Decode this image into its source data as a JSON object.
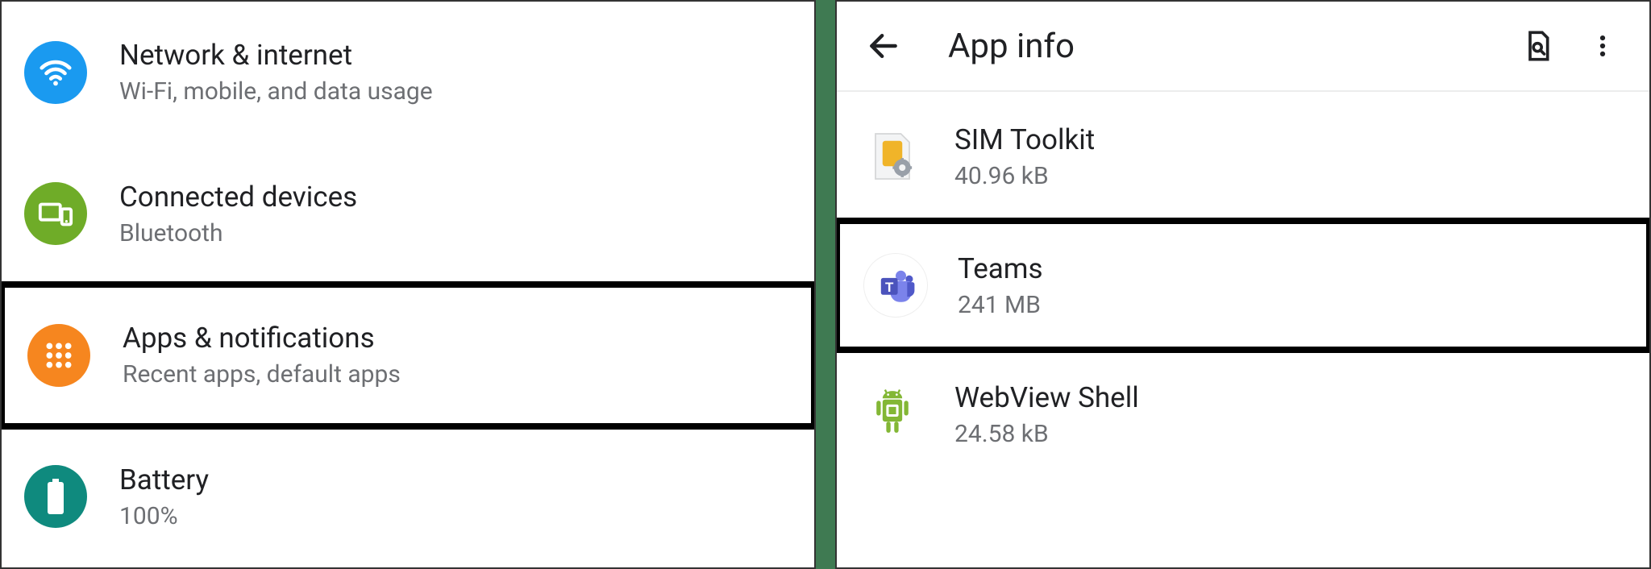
{
  "settings": {
    "items": [
      {
        "title": "Network & internet",
        "subtitle": "Wi-Fi, mobile, and data usage",
        "icon": "wifi-icon",
        "color": "#1a9af0",
        "highlight": false
      },
      {
        "title": "Connected devices",
        "subtitle": "Bluetooth",
        "icon": "devices-icon",
        "color": "#6fac28",
        "highlight": false
      },
      {
        "title": "Apps & notifications",
        "subtitle": "Recent apps, default apps",
        "icon": "apps-grid-icon",
        "color": "#f6861f",
        "highlight": true
      },
      {
        "title": "Battery",
        "subtitle": "100%",
        "icon": "battery-icon",
        "color": "#0f8a7e",
        "highlight": false
      }
    ]
  },
  "appinfo": {
    "header_title": "App info",
    "apps": [
      {
        "name": "SIM Toolkit",
        "size": "40.96 kB",
        "icon": "sim-card-icon",
        "highlight": false
      },
      {
        "name": "Teams",
        "size": "241 MB",
        "icon": "teams-icon",
        "highlight": true
      },
      {
        "name": "WebView Shell",
        "size": "24.58 kB",
        "icon": "android-robot-icon",
        "highlight": false
      }
    ]
  },
  "colors": {
    "text_primary": "#202124",
    "text_secondary": "#6d6f73",
    "divider": "#eceded",
    "gap_bg": "#3f7a52",
    "highlight_box": "#000000"
  }
}
